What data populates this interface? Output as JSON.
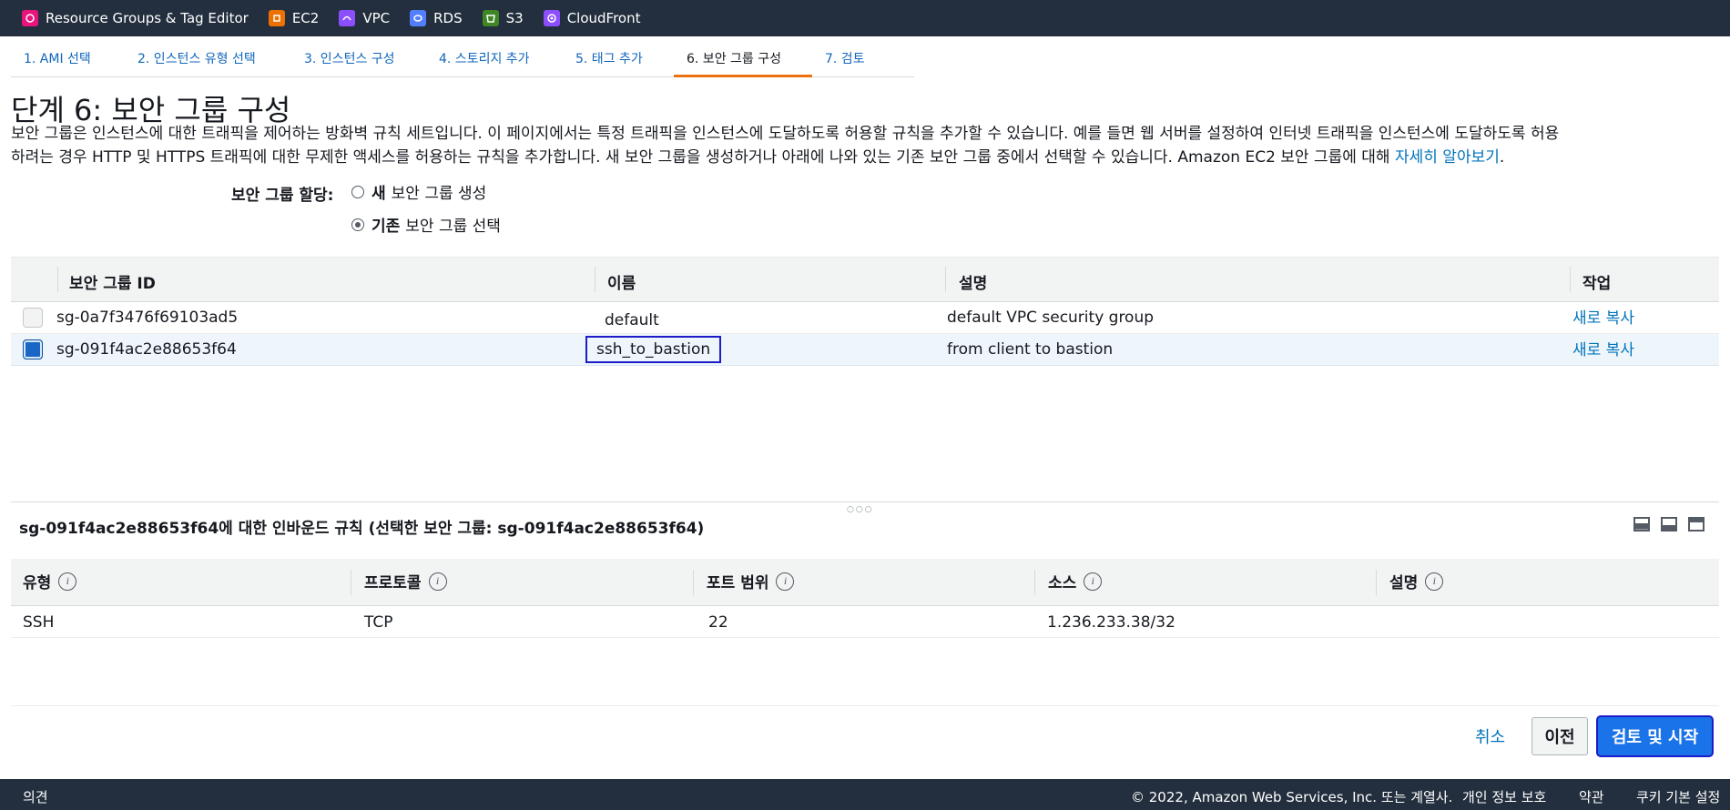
{
  "services": [
    {
      "label": "Resource Groups & Tag Editor",
      "color": "#e7157b",
      "icon": "resource-groups-icon"
    },
    {
      "label": "EC2",
      "color": "#ed7100",
      "icon": "ec2-icon"
    },
    {
      "label": "VPC",
      "color": "#8c4fff",
      "icon": "vpc-icon"
    },
    {
      "label": "RDS",
      "color": "#527fff",
      "icon": "rds-icon"
    },
    {
      "label": "S3",
      "color": "#3f8624",
      "icon": "s3-icon"
    },
    {
      "label": "CloudFront",
      "color": "#8c4fff",
      "icon": "cloudfront-icon"
    }
  ],
  "tabs": [
    {
      "label": "1. AMI 선택"
    },
    {
      "label": "2. 인스턴스 유형 선택"
    },
    {
      "label": "3. 인스턴스 구성"
    },
    {
      "label": "4. 스토리지 추가"
    },
    {
      "label": "5. 태그 추가"
    },
    {
      "label": "6. 보안 그룹 구성",
      "active": true
    },
    {
      "label": "7. 검토"
    }
  ],
  "page_title": "단계 6: 보안 그룹 구성",
  "description": {
    "line1": "보안 그룹은 인스턴스에 대한 트래픽을 제어하는 방화벽 규칙 세트입니다. 이 페이지에서는 특정 트래픽을 인스턴스에 도달하도록 허용할 규칙을 추가할 수 있습니다. 예를 들면 웹 서버를 설정하여 인터넷 트래픽을 인스턴스에 도달하도록 허용",
    "line2": "하려는 경우 HTTP 및 HTTPS 트래픽에 대한 무제한 액세스를 허용하는 규칙을 추가합니다. 새 보안 그룹을 생성하거나 아래에 나와 있는 기존 보안 그룹 중에서 선택할 수 있습니다. Amazon EC2 보안 그룹에 대해 ",
    "link": "자세히 알아보기",
    "end": "."
  },
  "assign": {
    "label": "보안 그룹 할당:",
    "new_bold": "새",
    "new_rest": "보안 그룹 생성",
    "existing_bold": "기존",
    "existing_rest": "보안 그룹 선택",
    "selected": "existing"
  },
  "sg_table": {
    "headers": {
      "id": "보안 그룹 ID",
      "name": "이름",
      "desc": "설명",
      "action": "작업"
    },
    "rows": [
      {
        "id": "sg-0a7f3476f69103ad5",
        "name": "default",
        "desc": "default VPC security group",
        "action": "새로 복사",
        "selected": false
      },
      {
        "id": "sg-091f4ac2e88653f64",
        "name": "ssh_to_bastion",
        "desc": "from client to bastion",
        "action": "새로 복사",
        "selected": true
      }
    ]
  },
  "inbound_title": "sg-091f4ac2e88653f64에 대한 인바운드 규칙 (선택한 보안 그룹: sg-091f4ac2e88653f64)",
  "rules_table": {
    "headers": {
      "type": "유형",
      "protocol": "프로토콜",
      "port": "포트 범위",
      "source": "소스",
      "desc": "설명"
    },
    "rows": [
      {
        "type": "SSH",
        "protocol": "TCP",
        "port": "22",
        "source": "1.236.233.38/32",
        "desc": ""
      }
    ]
  },
  "buttons": {
    "cancel": "취소",
    "prev": "이전",
    "review": "검토 및 시작"
  },
  "footer": {
    "feedback": "의견",
    "copyright": "© 2022, Amazon Web Services, Inc. 또는 계열사.",
    "privacy": "개인 정보 보호",
    "terms": "약관",
    "cookies": "쿠키 기본 설정"
  }
}
